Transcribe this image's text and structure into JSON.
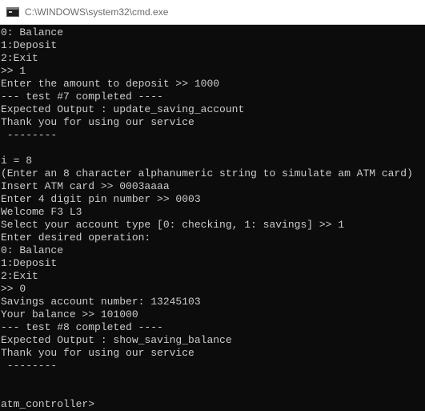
{
  "window": {
    "title": "C:\\WINDOWS\\system32\\cmd.exe",
    "icon": "cmd-icon"
  },
  "console": {
    "lines": [
      "0: Balance",
      "1:Deposit",
      "2:Exit",
      ">> 1",
      "Enter the amount to deposit >> 1000",
      "--- test #7 completed ----",
      "Expected Output : update_saving_account",
      "Thank you for using our service",
      " --------",
      "",
      "i = 8",
      "(Enter an 8 character alphanumeric string to simulate am ATM card)",
      "Insert ATM card >> 0003aaaa",
      "Enter 4 digit pin number >> 0003",
      "Welcome F3 L3",
      "Select your account type [0: checking, 1: savings] >> 1",
      "Enter desired operation:",
      "0: Balance",
      "1:Deposit",
      "2:Exit",
      ">> 0",
      "Savings account number: 13245103",
      "Your balance >> 101000",
      "--- test #8 completed ----",
      "Expected Output : show_saving_balance",
      "Thank you for using our service",
      " --------",
      "",
      "",
      "atm_controller>"
    ]
  },
  "colors": {
    "background": "#0c0c0c",
    "text": "#cccccc",
    "titlebar": "#ffffff",
    "title_text": "#6b6b6b"
  }
}
